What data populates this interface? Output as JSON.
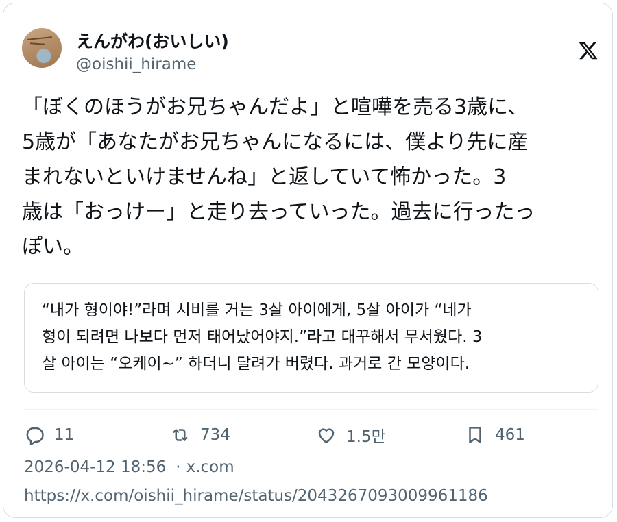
{
  "author": {
    "display_name": "えんがわ(おいしい)",
    "handle": "@oishii_hirame",
    "avatar_icon": "avatar-photo"
  },
  "platform": {
    "logo_icon": "x-logo-icon"
  },
  "tweet": {
    "text": "「ぼくのほうがお兄ちゃんだよ」と喧嘩を売る3歳に、\n5歳が「あなたがお兄ちゃんになるには、僕より先に産\nまれないといけませんね」と返していて怖かった。3\n歳は「おっけー」と走り去っていった。過去に行ったっ\nぽい。"
  },
  "translation": {
    "text": "“내가 형이야!”라며 시비를 거는 3살 아이에게, 5살 아이가 “네가\n형이 되려면 나보다 먼저 태어났어야지.”라고 대꾸해서 무서웠다. 3\n살 아이는 “오케이~” 하더니 달려가 버렸다. 과거로 간 모양이다."
  },
  "actions": {
    "reply": {
      "icon": "reply-icon",
      "count": "11"
    },
    "retweet": {
      "icon": "retweet-icon",
      "count": "734"
    },
    "like": {
      "icon": "heart-icon",
      "count": "1.5만"
    },
    "bookmark": {
      "icon": "bookmark-icon",
      "count": "461"
    }
  },
  "meta": {
    "timestamp": "2026-04-12 18:56",
    "separator": "·",
    "source": "x.com"
  },
  "url": "https://x.com/oishii_hirame/status/2043267093009961186",
  "colors": {
    "text_primary": "#0f1419",
    "text_secondary": "#536471",
    "border": "#d7dde2"
  }
}
